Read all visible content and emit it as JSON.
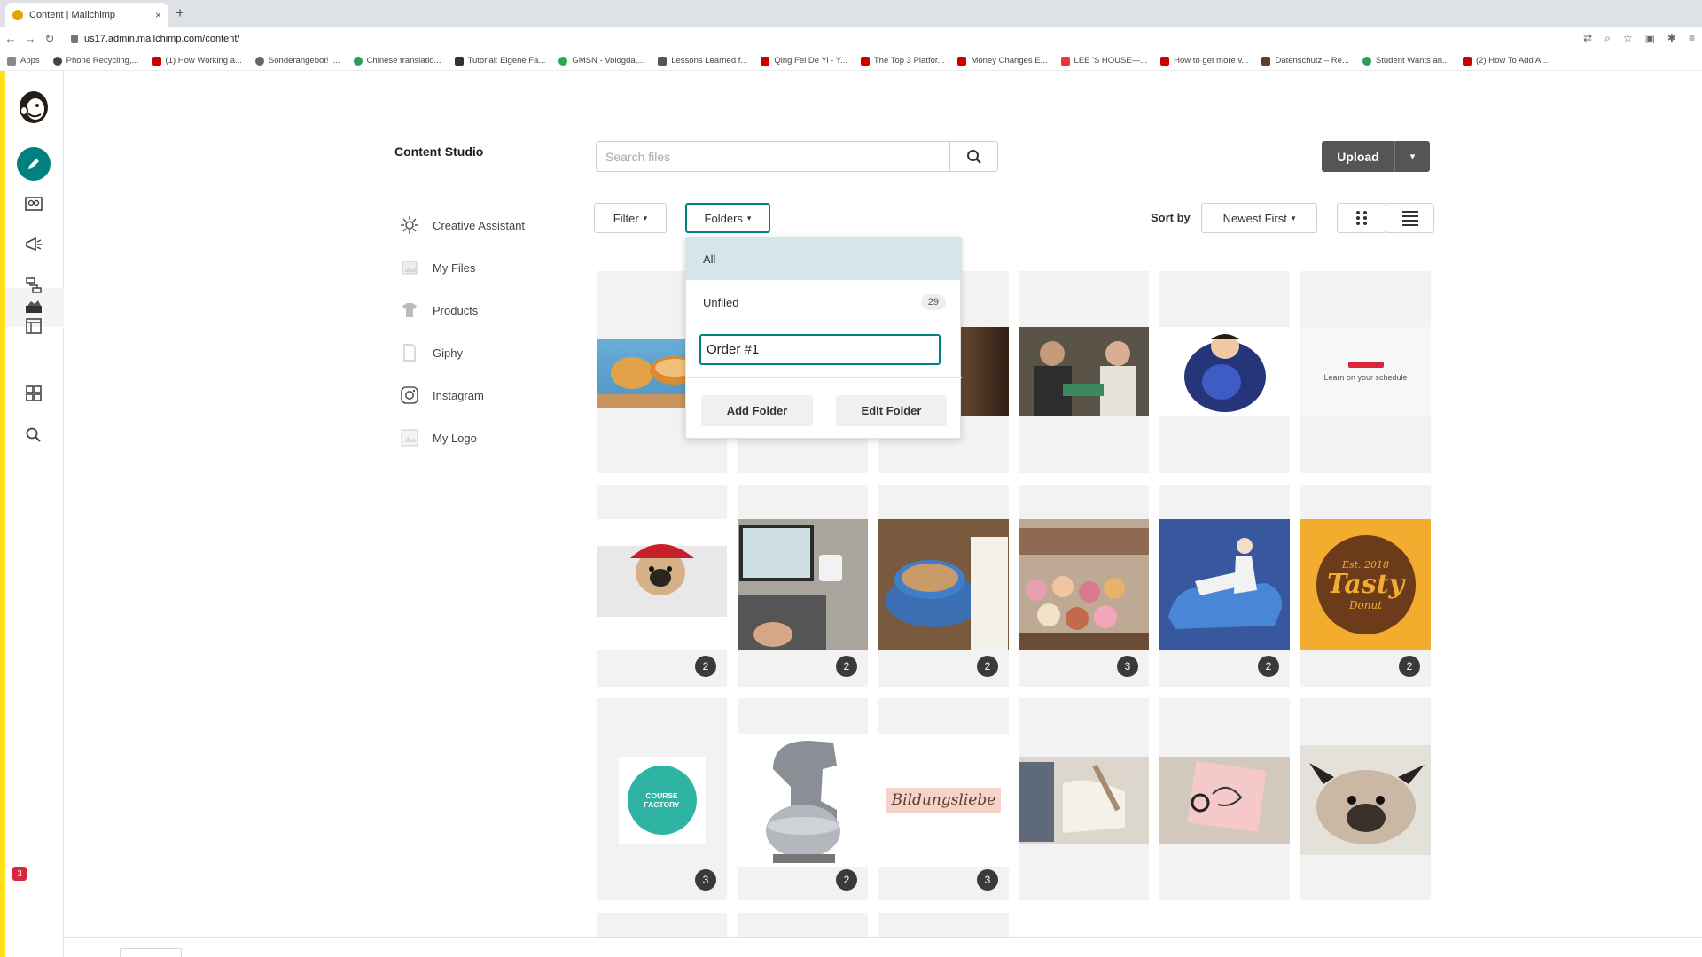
{
  "browser": {
    "tab_title": "Content | Mailchimp",
    "tab_close": "×",
    "new_tab": "+",
    "url": "us17.admin.mailchimp.com/content/",
    "bookmarks": [
      "Apps",
      "Phone Recycling,...",
      "(1) How Working a...",
      "Sonderangebot! |...",
      "Chinese translatio...",
      "Tutorial: Eigene Fa...",
      "GMSN - Vologda,...",
      "Lessons Learned f...",
      "Qing Fei De Yi - Y...",
      "The Top 3 Platfor...",
      "Money Changes E...",
      "LEE 'S HOUSE—...",
      "How to get more v...",
      "Datenschutz – Re...",
      "Student Wants an...",
      "(2) How To Add A..."
    ]
  },
  "rail": {
    "notification_count": "3",
    "accent_color": "#ffe01b",
    "brand_color": "#00807f"
  },
  "header": {
    "title": "Content Studio",
    "search_placeholder": "Search files",
    "upload_label": "Upload"
  },
  "toolbar": {
    "filter_label": "Filter",
    "folders_label": "Folders",
    "sort_by_label": "Sort by",
    "sort_value": "Newest First"
  },
  "sidebar": {
    "items": [
      {
        "label": "Creative Assistant",
        "icon": "sparkle-icon"
      },
      {
        "label": "My Files",
        "icon": "image-icon"
      },
      {
        "label": "Products",
        "icon": "shirt-icon"
      },
      {
        "label": "Giphy",
        "icon": "file-icon"
      },
      {
        "label": "Instagram",
        "icon": "instagram-icon"
      },
      {
        "label": "My Logo",
        "icon": "logo-image-icon"
      }
    ]
  },
  "folders_dropdown": {
    "all_label": "All",
    "unfiled_label": "Unfiled",
    "unfiled_count": "29",
    "new_folder_value": "Order #1",
    "add_folder_label": "Add Folder",
    "edit_folder_label": "Edit Folder"
  },
  "grid": {
    "thumb_texts": {
      "ad_text": "Learn on your schedule",
      "course_factory": "COURSE FACTORY",
      "tasty_est": "Est. 2018",
      "tasty_name": "Tasty",
      "tasty_sub": "Donut",
      "script_word": "Bildungsliebe"
    },
    "row2_badges": [
      "2",
      "2",
      "2",
      "3",
      "2",
      "2"
    ],
    "row3_badges": [
      "3",
      "2",
      "3"
    ]
  }
}
